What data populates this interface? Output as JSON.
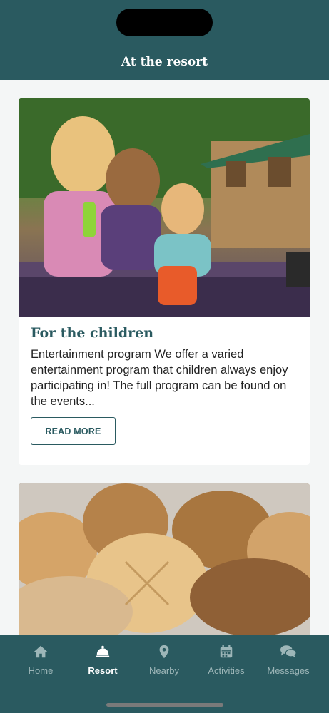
{
  "header": {
    "title": "At the resort"
  },
  "cards": [
    {
      "title": "For the children",
      "description": "Entertainment program We offer a varied entertainment program that children always enjoy participating in! The full program can be found on the events...",
      "button_label": "READ MORE"
    },
    {
      "title": "",
      "description": ""
    }
  ],
  "tabs": [
    {
      "label": "Home",
      "icon": "house-icon"
    },
    {
      "label": "Resort",
      "icon": "bell-icon"
    },
    {
      "label": "Nearby",
      "icon": "map-pin-icon"
    },
    {
      "label": "Activities",
      "icon": "calendar-icon"
    },
    {
      "label": "Messages",
      "icon": "chat-icon"
    }
  ],
  "colors": {
    "brand": "#2a5a60",
    "tab_inactive": "#9db6b8",
    "tab_active": "#ffffff"
  }
}
